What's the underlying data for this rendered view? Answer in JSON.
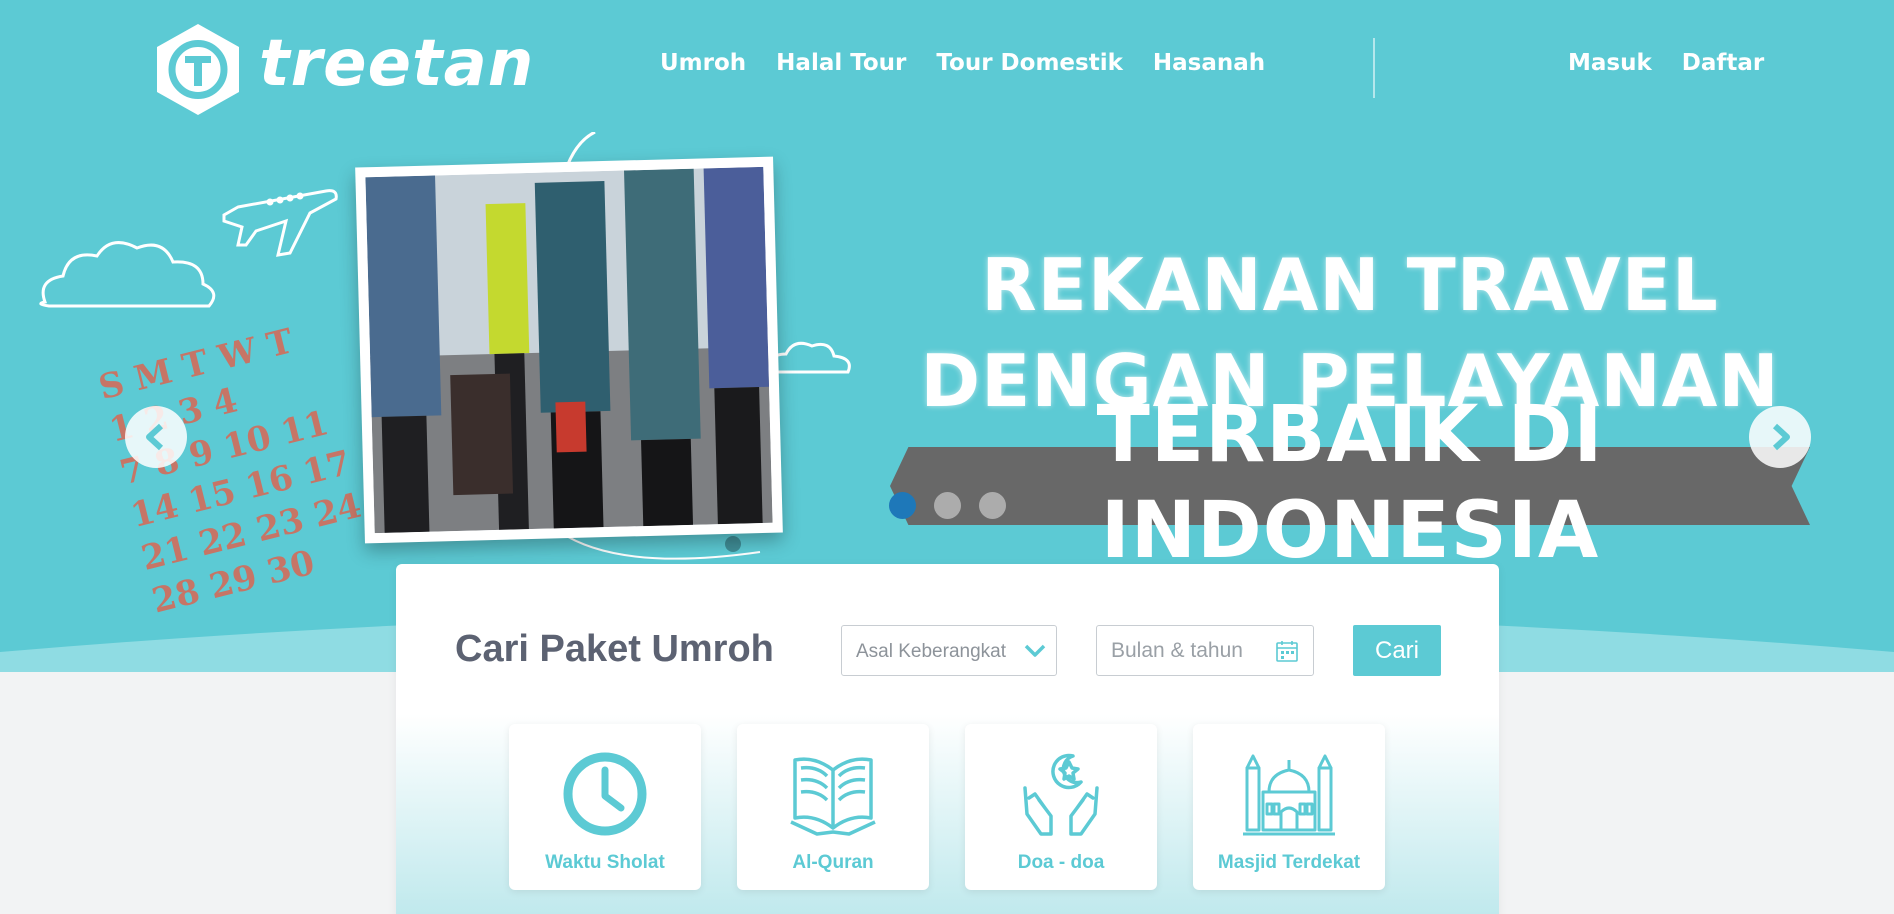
{
  "brand": {
    "name": "treetan",
    "primary_color": "#5ccad4",
    "accent_dot_color": "#1e78b9"
  },
  "nav": {
    "items": [
      "Umroh",
      "Halal Tour",
      "Tour Domestik",
      "Hasanah"
    ],
    "login": "Masuk",
    "register": "Daftar"
  },
  "hero": {
    "headline_line1": "REKANAN TRAVEL",
    "headline_line2": "DENGAN PELAYANAN",
    "headline_line3": "TERBAIK DI INDONESIA",
    "calendar_rows": [
      "S M T W T",
      "1 2 3 4",
      "7 8 9 10 11",
      "14 15 16 17 18",
      "21 22 23 24",
      "28 29 30"
    ],
    "slides_total": 3,
    "active_slide": 1,
    "prev_icon": "chevron-left-icon",
    "next_icon": "chevron-right-icon"
  },
  "search": {
    "title": "Cari Paket Umroh",
    "origin_select_value": "Asal Keberangkatan",
    "date_placeholder": "Bulan & tahun",
    "submit_label": "Cari"
  },
  "features": [
    {
      "label": "Waktu Sholat",
      "icon": "clock-icon"
    },
    {
      "label": "Al-Quran",
      "icon": "quran-book-icon"
    },
    {
      "label": "Doa - doa",
      "icon": "praying-hands-icon"
    },
    {
      "label": "Masjid Terdekat",
      "icon": "mosque-icon"
    }
  ]
}
